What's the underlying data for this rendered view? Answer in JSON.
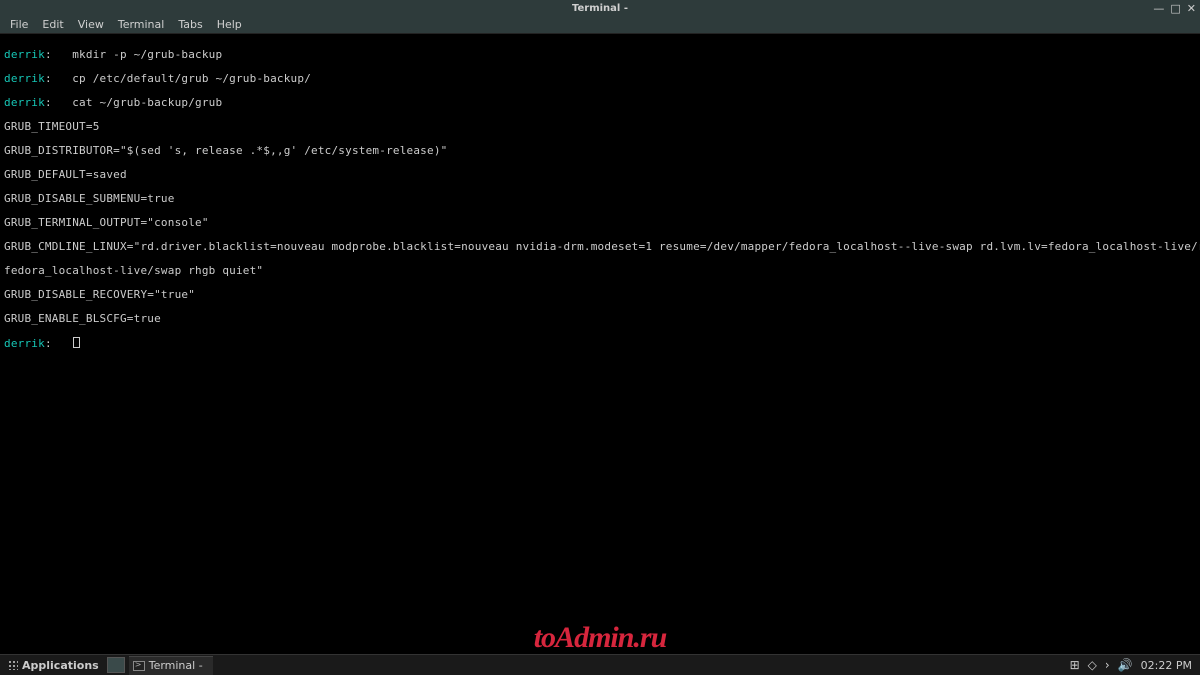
{
  "window": {
    "title": "Terminal -",
    "minimize": "—",
    "maximize": "□",
    "close": "✕"
  },
  "menu": {
    "file": "File",
    "edit": "Edit",
    "view": "View",
    "terminal": "Terminal",
    "tabs": "Tabs",
    "help": "Help"
  },
  "prompt_user": "derrik",
  "commands": {
    "c1": " mkdir -p ~/grub-backup",
    "c2": " cp /etc/default/grub ~/grub-backup/",
    "c3": " cat ~/grub-backup/grub"
  },
  "output": {
    "l1": "GRUB_TIMEOUT=5",
    "l2": "GRUB_DISTRIBUTOR=\"$(sed 's, release .*$,,g' /etc/system-release)\"",
    "l3": "GRUB_DEFAULT=saved",
    "l4": "GRUB_DISABLE_SUBMENU=true",
    "l5": "GRUB_TERMINAL_OUTPUT=\"console\"",
    "l6a": "GRUB_CMDLINE_LINUX=\"rd.driver.blacklist=nouveau modprobe.blacklist=nouveau nvidia-drm.modeset=1 resume=/dev/mapper/fedora_localhost--live-swap rd.lvm.lv=fedora_localhost-live/root rd.lvm.lv=",
    "l6b": "fedora_localhost-live/swap rhgb quiet\"",
    "l7": "GRUB_DISABLE_RECOVERY=\"true\"",
    "l8": "GRUB_ENABLE_BLSCFG=true"
  },
  "prompt_sep": ":  ",
  "taskbar": {
    "apps": "Applications",
    "task": "Terminal -",
    "clock": "02:22 PM"
  },
  "watermark": "toAdmin.ru"
}
